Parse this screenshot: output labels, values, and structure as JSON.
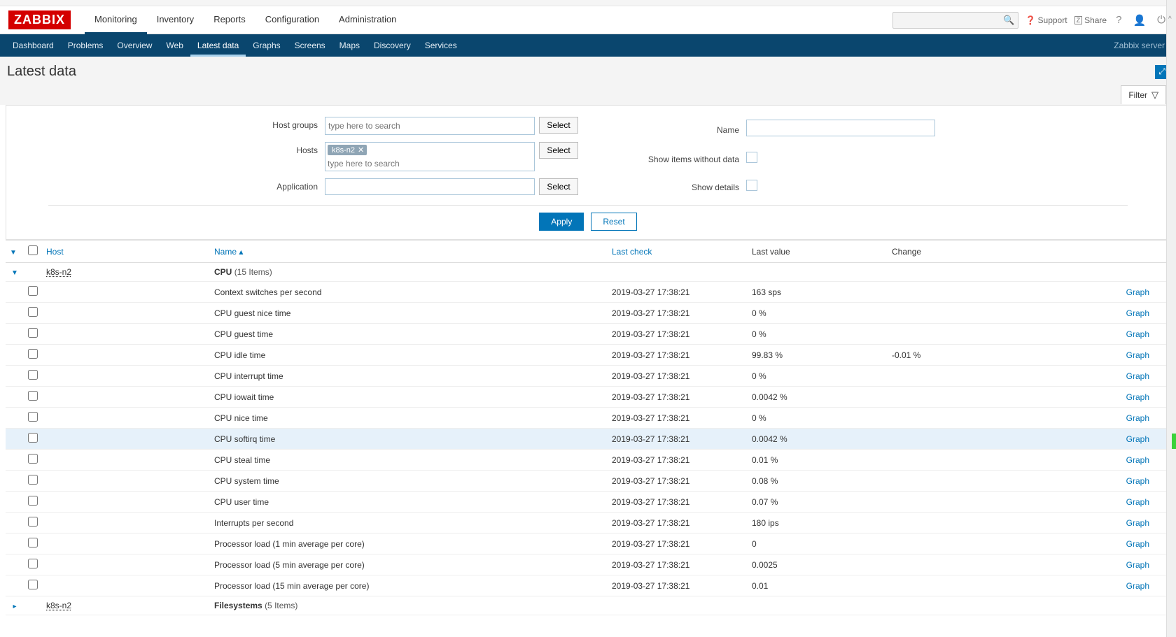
{
  "logo": "ZABBIX",
  "mainnav": [
    "Monitoring",
    "Inventory",
    "Reports",
    "Configuration",
    "Administration"
  ],
  "mainnav_active": "Monitoring",
  "header": {
    "support": "Support",
    "share": "Share"
  },
  "subnav": [
    "Dashboard",
    "Problems",
    "Overview",
    "Web",
    "Latest data",
    "Graphs",
    "Screens",
    "Maps",
    "Discovery",
    "Services"
  ],
  "subnav_active": "Latest data",
  "server_label": "Zabbix server",
  "page_title": "Latest data",
  "filter_tab": "Filter",
  "filter": {
    "host_groups_label": "Host groups",
    "host_groups_placeholder": "type here to search",
    "hosts_label": "Hosts",
    "hosts_tag": "k8s-n2",
    "hosts_placeholder": "type here to search",
    "application_label": "Application",
    "name_label": "Name",
    "show_items_label": "Show items without data",
    "show_details_label": "Show details",
    "select_btn": "Select",
    "apply": "Apply",
    "reset": "Reset"
  },
  "columns": {
    "host": "Host",
    "name": "Name",
    "last_check": "Last check",
    "last_value": "Last value",
    "change": "Change"
  },
  "group1": {
    "host": "k8s-n2",
    "app": "CPU",
    "count": "(15 Items)"
  },
  "group2": {
    "host": "k8s-n2",
    "app": "Filesystems",
    "count": "(5 Items)"
  },
  "rows": [
    {
      "name": "Context switches per second",
      "last": "2019-03-27 17:38:21",
      "val": "163 sps",
      "chg": "",
      "act": "Graph"
    },
    {
      "name": "CPU guest nice time",
      "last": "2019-03-27 17:38:21",
      "val": "0 %",
      "chg": "",
      "act": "Graph"
    },
    {
      "name": "CPU guest time",
      "last": "2019-03-27 17:38:21",
      "val": "0 %",
      "chg": "",
      "act": "Graph"
    },
    {
      "name": "CPU idle time",
      "last": "2019-03-27 17:38:21",
      "val": "99.83 %",
      "chg": "-0.01 %",
      "act": "Graph"
    },
    {
      "name": "CPU interrupt time",
      "last": "2019-03-27 17:38:21",
      "val": "0 %",
      "chg": "",
      "act": "Graph"
    },
    {
      "name": "CPU iowait time",
      "last": "2019-03-27 17:38:21",
      "val": "0.0042 %",
      "chg": "",
      "act": "Graph"
    },
    {
      "name": "CPU nice time",
      "last": "2019-03-27 17:38:21",
      "val": "0 %",
      "chg": "",
      "act": "Graph"
    },
    {
      "name": "CPU softirq time",
      "last": "2019-03-27 17:38:21",
      "val": "0.0042 %",
      "chg": "",
      "act": "Graph",
      "hover": true
    },
    {
      "name": "CPU steal time",
      "last": "2019-03-27 17:38:21",
      "val": "0.01 %",
      "chg": "",
      "act": "Graph"
    },
    {
      "name": "CPU system time",
      "last": "2019-03-27 17:38:21",
      "val": "0.08 %",
      "chg": "",
      "act": "Graph"
    },
    {
      "name": "CPU user time",
      "last": "2019-03-27 17:38:21",
      "val": "0.07 %",
      "chg": "",
      "act": "Graph"
    },
    {
      "name": "Interrupts per second",
      "last": "2019-03-27 17:38:21",
      "val": "180 ips",
      "chg": "",
      "act": "Graph"
    },
    {
      "name": "Processor load (1 min average per core)",
      "last": "2019-03-27 17:38:21",
      "val": "0",
      "chg": "",
      "act": "Graph"
    },
    {
      "name": "Processor load (5 min average per core)",
      "last": "2019-03-27 17:38:21",
      "val": "0.0025",
      "chg": "",
      "act": "Graph"
    },
    {
      "name": "Processor load (15 min average per core)",
      "last": "2019-03-27 17:38:21",
      "val": "0.01",
      "chg": "",
      "act": "Graph"
    }
  ]
}
